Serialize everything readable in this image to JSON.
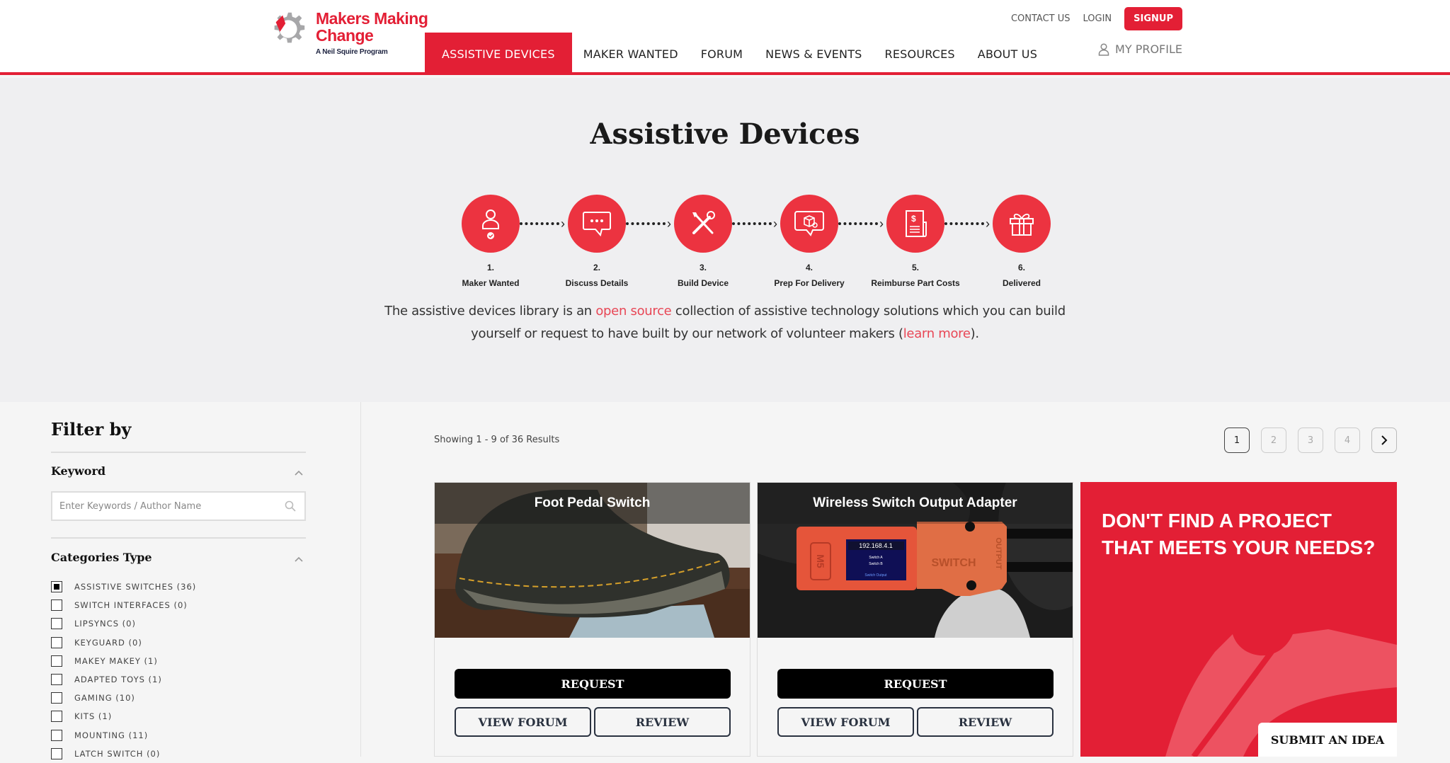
{
  "header": {
    "logo": {
      "brand_line1": "Makers Making",
      "brand_line2": "Change",
      "tagline": "A Neil Squire Program"
    },
    "top_links": {
      "contact": "CONTACT US",
      "login": "LOGIN",
      "signup": "SIGNUP"
    },
    "nav": [
      {
        "label": "ASSISTIVE DEVICES",
        "active": true
      },
      {
        "label": "MAKER WANTED"
      },
      {
        "label": "FORUM"
      },
      {
        "label": "NEWS & EVENTS"
      },
      {
        "label": "RESOURCES"
      },
      {
        "label": "ABOUT US"
      }
    ],
    "profile": "MY PROFILE"
  },
  "hero": {
    "title": "Assistive Devices",
    "steps": [
      {
        "num": "1.",
        "label": "Maker Wanted",
        "icon": "person-check-icon"
      },
      {
        "num": "2.",
        "label": "Discuss Details",
        "icon": "chat-bubble-icon"
      },
      {
        "num": "3.",
        "label": "Build Device",
        "icon": "tools-icon"
      },
      {
        "num": "4.",
        "label": "Prep For Delivery",
        "icon": "package-icon"
      },
      {
        "num": "5.",
        "label": "Reimburse Part Costs",
        "icon": "receipt-icon"
      },
      {
        "num": "6.",
        "label": "Delivered",
        "icon": "gift-icon"
      }
    ],
    "desc_part1": "The assistive devices library is an ",
    "desc_link1": "open source",
    "desc_part2": " collection of assistive technology solutions which you can build yourself or request to have built by our network of volunteer makers (",
    "desc_link2": "learn more",
    "desc_part3": ")."
  },
  "sidebar": {
    "title": "Filter by",
    "keyword_title": "Keyword",
    "keyword_placeholder": "Enter Keywords / Author Name",
    "keyword_value": "",
    "categories_title": "Categories Type",
    "categories": [
      {
        "label": "ASSISTIVE SWITCHES (36)",
        "checked": true
      },
      {
        "label": "SWITCH INTERFACES (0)",
        "checked": false
      },
      {
        "label": "LIPSYNCS (0)",
        "checked": false
      },
      {
        "label": "KEYGUARD (0)",
        "checked": false
      },
      {
        "label": "MAKEY MAKEY (1)",
        "checked": false
      },
      {
        "label": "ADAPTED TOYS (1)",
        "checked": false
      },
      {
        "label": "GAMING (10)",
        "checked": false
      },
      {
        "label": "KITS (1)",
        "checked": false
      },
      {
        "label": "MOUNTING (11)",
        "checked": false
      },
      {
        "label": "LATCH SWITCH (0)",
        "checked": false
      }
    ]
  },
  "results": {
    "showing": "Showing 1 - 9 of 36 Results",
    "pages": [
      "1",
      "2",
      "3",
      "4"
    ],
    "current_page": "1",
    "cards": [
      {
        "title": "Foot Pedal Switch",
        "request": "REQUEST",
        "forum": "VIEW FORUM",
        "review": "REVIEW"
      },
      {
        "title": "Wireless Switch Output Adapter",
        "request": "REQUEST",
        "forum": "VIEW FORUM",
        "review": "REVIEW",
        "screen_text": [
          "192.168.4.1",
          "Switch A",
          "Switch B",
          "Switch Output"
        ],
        "device_label": [
          "M5",
          "SWITCH",
          "OUTPUT"
        ]
      }
    ],
    "cta": {
      "title": "DON'T FIND A PROJECT THAT MEETS YOUR NEEDS?",
      "button": "SUBMIT AN IDEA"
    }
  },
  "colors": {
    "brand_red": "#e31f35",
    "step_red": "#ec3340",
    "link_red": "#e84756",
    "hero_bg": "#efeff1",
    "page_bg": "#f5f5f5"
  }
}
